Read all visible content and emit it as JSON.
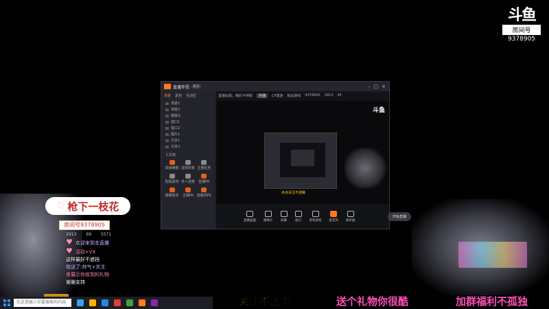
{
  "room_logo": {
    "mark": "斗鱼",
    "label": "房间号",
    "room_id": "9378905"
  },
  "app": {
    "name": "直播伴侣",
    "version": "6.1",
    "sidebar_tabs": [
      "场景",
      "素材",
      "互动区"
    ],
    "scenes": [
      "场景1",
      "场景2",
      "摄像头",
      "窗口1",
      "窗口2",
      "图片1",
      "文本1",
      "文本2"
    ],
    "tools_title": "工具箱",
    "tools": [
      "高级美颜",
      "虚拟形象",
      "主播任务",
      "贴纸素材",
      "多人连麦",
      "直播PK",
      "弹幕助手",
      "主播PK",
      "直播间PK"
    ],
    "stream_info": [
      "直播标题，精彩不停歇",
      "开播",
      "CF端游",
      "枪战游戏",
      "9378905",
      "2913",
      "45"
    ],
    "toolbar": [
      "直播画面",
      "摄像头",
      "屏幕",
      "窗口",
      "游戏进程",
      "麦克风",
      "扬声器"
    ],
    "start_label": "开始直播",
    "status": "已开播"
  },
  "nameplate": {
    "heart": "♡",
    "text": "枪下一枝花"
  },
  "room_tag": "房间号9378905",
  "chat": {
    "stats": [
      "2913",
      "69",
      "5571"
    ],
    "rows": [
      {
        "text": "欢迎来到本直播",
        "cls": "lav"
      },
      {
        "text": "活动+VX",
        "cls": "pink"
      },
      {
        "text": "这样最好不遮挡",
        "cls": ""
      },
      {
        "text": "赠送了:帅气+关注",
        "cls": "lav"
      },
      {
        "text": "里展示你收到的礼物",
        "cls": "pink"
      },
      {
        "text": "谢谢支持",
        "cls": ""
      }
    ]
  },
  "taskbar": {
    "search_placeholder": "在这里输入你要搜索的内容"
  },
  "captions": [
    "点点关注不迷路",
    "送个礼物你很酷",
    "加群福利不孤独"
  ]
}
